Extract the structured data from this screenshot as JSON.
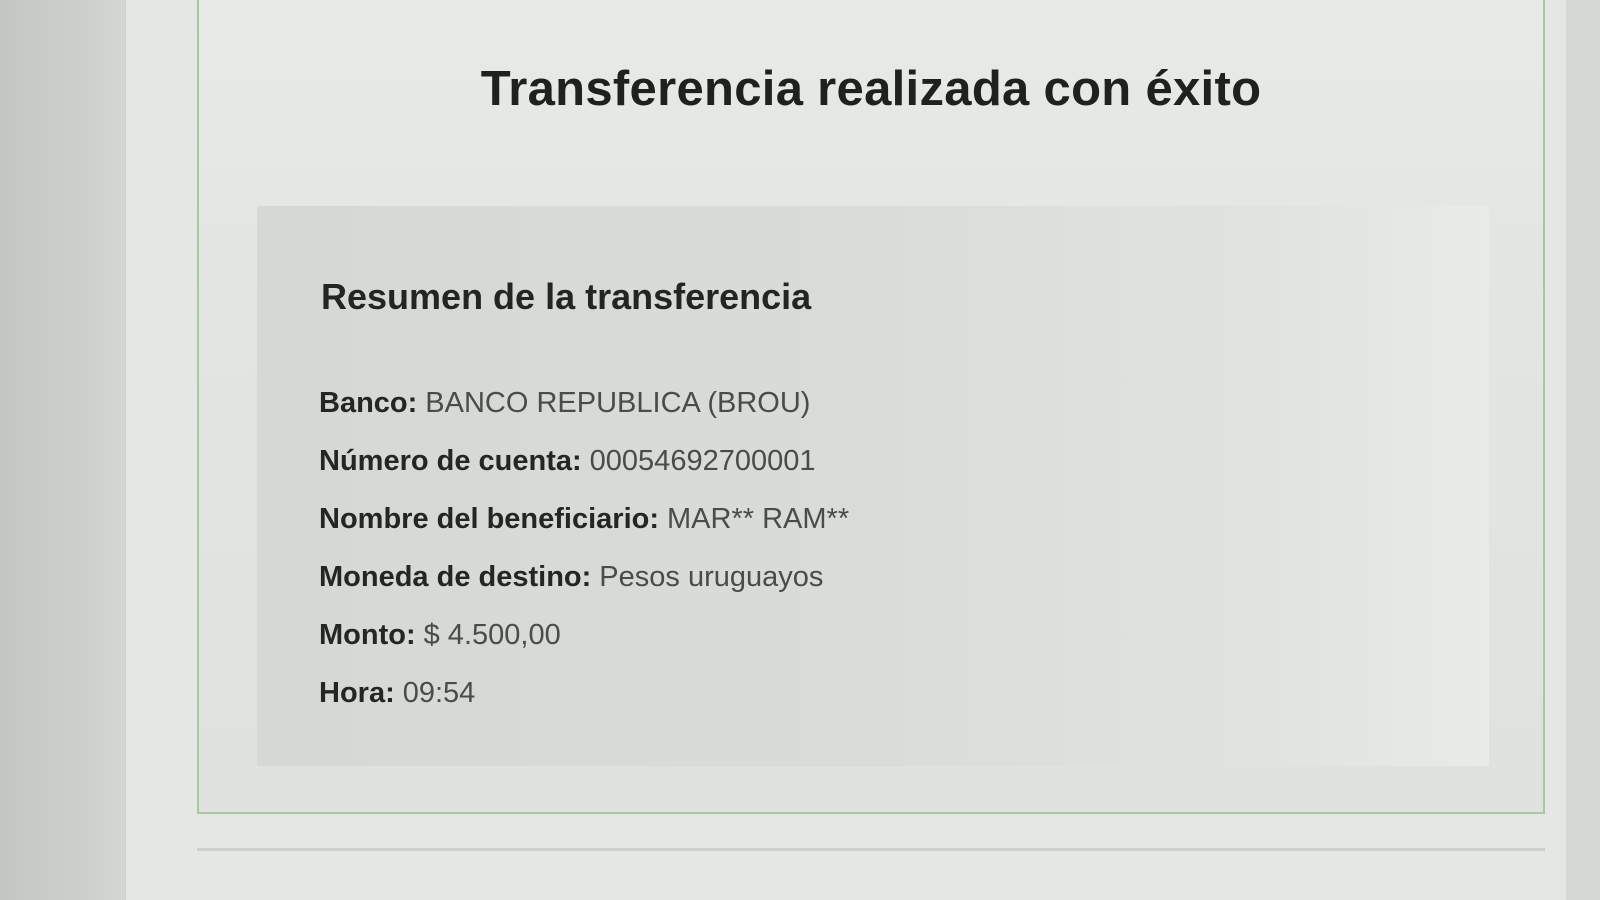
{
  "success_title": "Transferencia realizada con éxito",
  "summary": {
    "heading": "Resumen de la transferencia",
    "details": [
      {
        "label": "Banco:",
        "value": "BANCO REPUBLICA (BROU)"
      },
      {
        "label": "Número de cuenta:",
        "value": "00054692700001"
      },
      {
        "label": "Nombre del beneficiario:",
        "value": "MAR** RAM**"
      },
      {
        "label": "Moneda de destino:",
        "value": "Pesos uruguayos"
      },
      {
        "label": "Monto:",
        "value": "$ 4.500,00"
      },
      {
        "label": "Hora:",
        "value": "09:54"
      }
    ]
  },
  "colors": {
    "card_border": "#a9c7a1",
    "title_text": "#1f211f",
    "value_text": "#4a4c4a"
  }
}
